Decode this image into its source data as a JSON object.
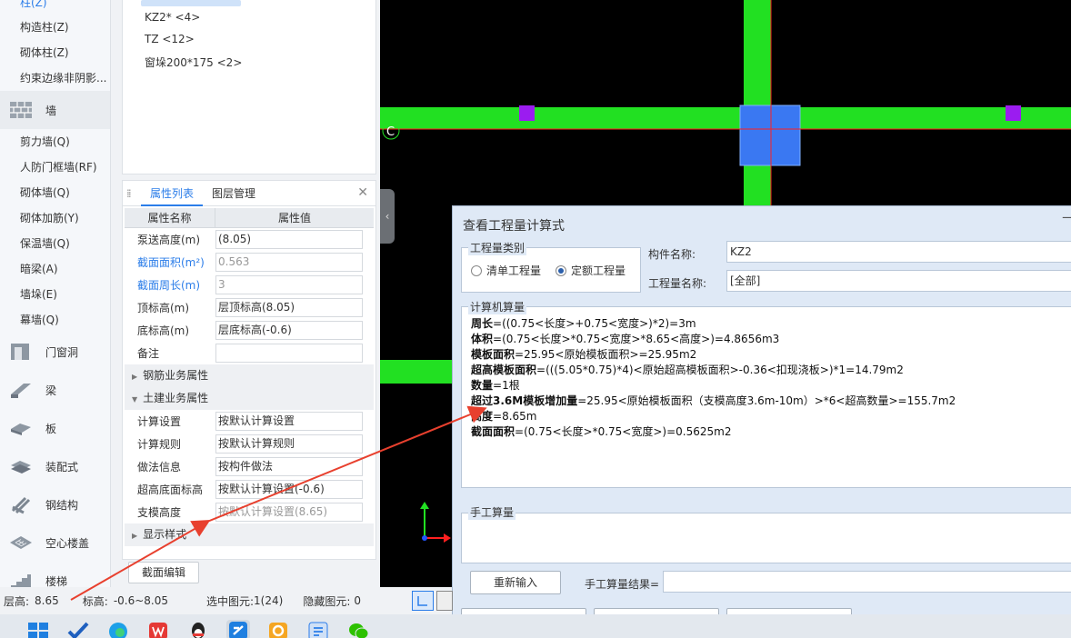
{
  "left_nav": {
    "top_items": [
      {
        "label": "柱(Z)",
        "active": true
      },
      {
        "label": "构造柱(Z)"
      },
      {
        "label": "砌体柱(Z)"
      },
      {
        "label": "约束边缘非阴影..."
      }
    ],
    "wall_category": "墙",
    "wall_items": [
      "剪力墙(Q)",
      "人防门框墙(RF)",
      "砌体墙(Q)",
      "砌体加筋(Y)",
      "保温墙(Q)",
      "暗梁(A)",
      "墙垛(E)",
      "幕墙(Q)"
    ],
    "categories": [
      "门窗洞",
      "梁",
      "板",
      "装配式",
      "钢结构",
      "空心楼盖",
      "楼梯"
    ]
  },
  "tree": {
    "items": [
      "KZ2* <4>",
      "TZ <12>",
      "窗垛200*175 <2>"
    ]
  },
  "property_panel": {
    "tabs": [
      "属性列表",
      "图层管理"
    ],
    "header_name": "属性名称",
    "header_value": "属性值",
    "rows_a": [
      {
        "name": "泵送高度(m)",
        "value": "(8.05)"
      },
      {
        "name": "截面面积(m²)",
        "value": "0.563",
        "blue": true,
        "gray": true
      },
      {
        "name": "截面周长(m)",
        "value": "3",
        "blue": true,
        "gray": true
      },
      {
        "name": "顶标高(m)",
        "value": "层顶标高(8.05)"
      },
      {
        "name": "底标高(m)",
        "value": "层底标高(-0.6)"
      },
      {
        "name": "备注",
        "value": ""
      }
    ],
    "group_rebar": "钢筋业务属性",
    "group_civil": "土建业务属性",
    "rows_b": [
      {
        "name": "计算设置",
        "value": "按默认计算设置"
      },
      {
        "name": "计算规则",
        "value": "按默认计算规则"
      },
      {
        "name": "做法信息",
        "value": "按构件做法"
      },
      {
        "name": "超高底面标高",
        "value": "按默认计算设置(-0.6)"
      },
      {
        "name": "支模高度",
        "value": "按默认计算设置(8.65)",
        "gray": true
      }
    ],
    "group_display": "显示样式",
    "edit_button": "截面编辑"
  },
  "status_bar": {
    "floor_height_label": "层高:",
    "floor_height": "8.65",
    "elevation_label": "标高:",
    "elevation": "-0.6~8.05",
    "selected_label": "选中图元:",
    "selected": "1(24)",
    "hidden_label": "隐藏图元:",
    "hidden": "0"
  },
  "canvas": {
    "axis_label": "C",
    "colors": {
      "wall": "#22e022",
      "column": "#3a78f2",
      "small_column": "#9b1cf0",
      "axis": "#ff2020"
    }
  },
  "dialog": {
    "title": "查看工程量计算式",
    "qty_type_label": "工程量类别",
    "radio_list": "清单工程量",
    "radio_quota": "定额工程量",
    "selected_radio": "quota",
    "component_name_label": "构件名称:",
    "component_name": "KZ2",
    "qty_name_label": "工程量名称:",
    "qty_name": "[全部]",
    "computed_label": "计算机算量",
    "formulas": [
      {
        "bold": "周长",
        "rest": "=((0.75<长度>+0.75<宽度>)*2)=3m"
      },
      {
        "bold": "体积",
        "rest": "=(0.75<长度>*0.75<宽度>*8.65<高度>)=4.8656m3"
      },
      {
        "bold": "模板面积",
        "rest": "=25.95<原始模板面积>=25.95m2"
      },
      {
        "bold": "超高模板面积",
        "rest": "=(((5.05*0.75)*4)<原始超高模板面积>-0.36<扣现浇板>)*1=14.79m2"
      },
      {
        "bold": "数量",
        "rest": "=1根"
      },
      {
        "bold": "超过3.6M模板增加量",
        "rest": "=25.95<原始模板面积（支模高度3.6m-10m）>*6<超高数量>=155.7m2"
      },
      {
        "bold": "高度",
        "rest": "=8.65m"
      },
      {
        "bold": "截面面积",
        "rest": "=(0.75<长度>*0.75<宽度>)=0.5625m2"
      }
    ],
    "manual_label": "手工算量",
    "reenter_button": "重新输入",
    "manual_result_label": "手工算量结果="
  }
}
